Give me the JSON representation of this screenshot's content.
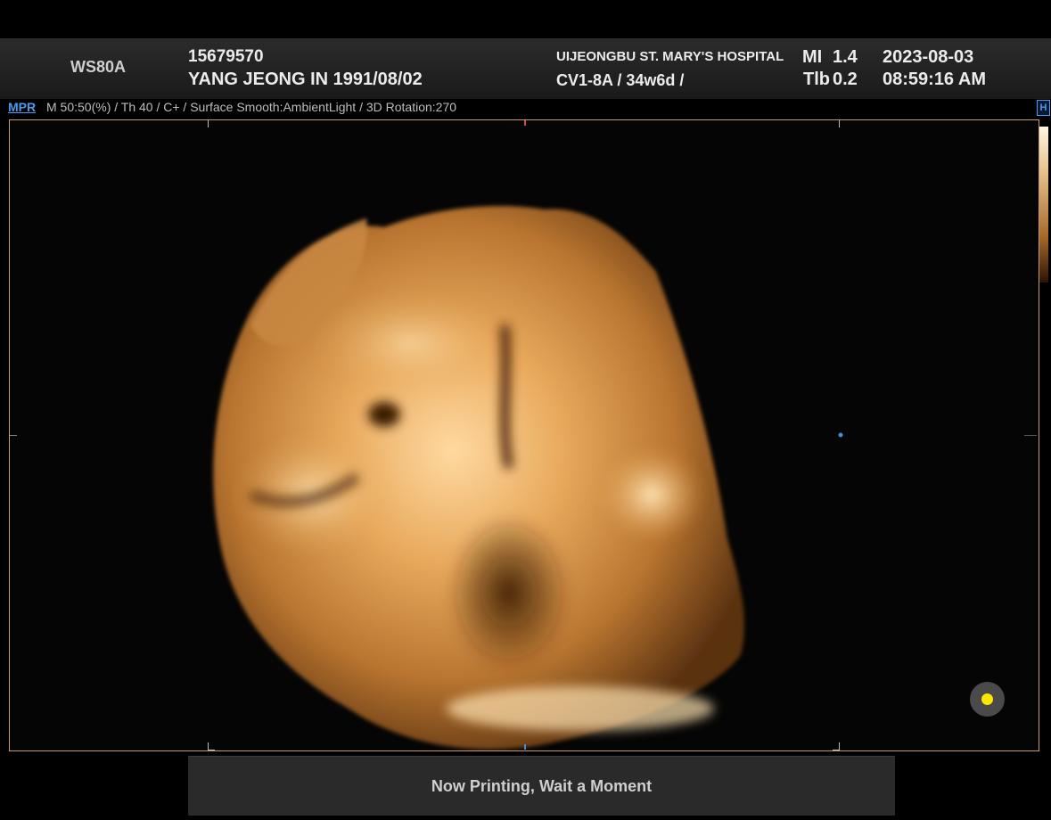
{
  "header": {
    "system_model": "WS80A",
    "patient_id": "15679570",
    "patient_name_dob": "YANG JEONG IN 1991/08/02",
    "hospital": "UIJEONGBU ST. MARY'S HOSPITAL",
    "probe_ga": "CV1-8A / 34w6d /",
    "mi_label": "MI",
    "mi_value": "1.4",
    "tib_label": "Tlb",
    "tib_value": "0.2",
    "date": "2023-08-03",
    "time": "08:59:16 AM"
  },
  "infobar": {
    "mode": "MPR",
    "parameters": "M 50:50(%) / Th 40 / C+ / Surface Smooth:AmbientLight / 3D Rotation:270",
    "side_button": "H"
  },
  "status": {
    "message": "Now Printing, Wait a Moment"
  },
  "colors": {
    "accent_blue": "#4a9af0",
    "frame_border": "#c69b72",
    "render_tint": "#d89a4a",
    "pointer_dot": "#ffe600"
  },
  "icons": {
    "pointer": "trackball-cursor-icon"
  }
}
